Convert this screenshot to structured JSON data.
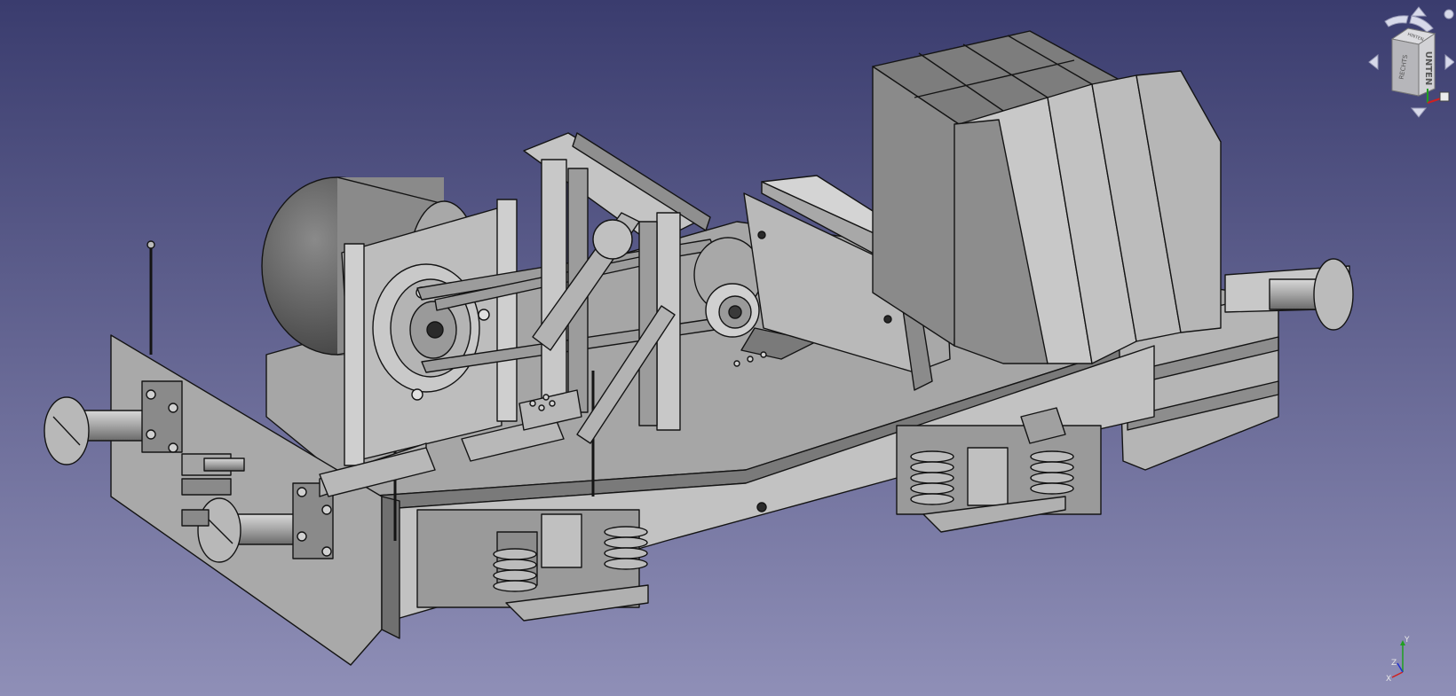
{
  "viewport": {
    "background_top": "#3a3c6e",
    "background_bottom": "#8f8fb7"
  },
  "model": {
    "metal_light": "#b9b9b9",
    "metal_mid": "#9d9d9d",
    "metal_dark": "#6c6c6c",
    "edge": "#141414"
  },
  "navcube": {
    "face_front": "UNTEN",
    "face_left": "RECHTS",
    "face_top": "HINTEN",
    "arrow_color": "#d7d9ea",
    "cube_color": "#c8c8cc"
  },
  "axis": {
    "x_label": "X",
    "y_label": "Y",
    "z_label": "Z",
    "x_color": "#d02020",
    "y_color": "#20a020",
    "z_color": "#2030d0"
  }
}
